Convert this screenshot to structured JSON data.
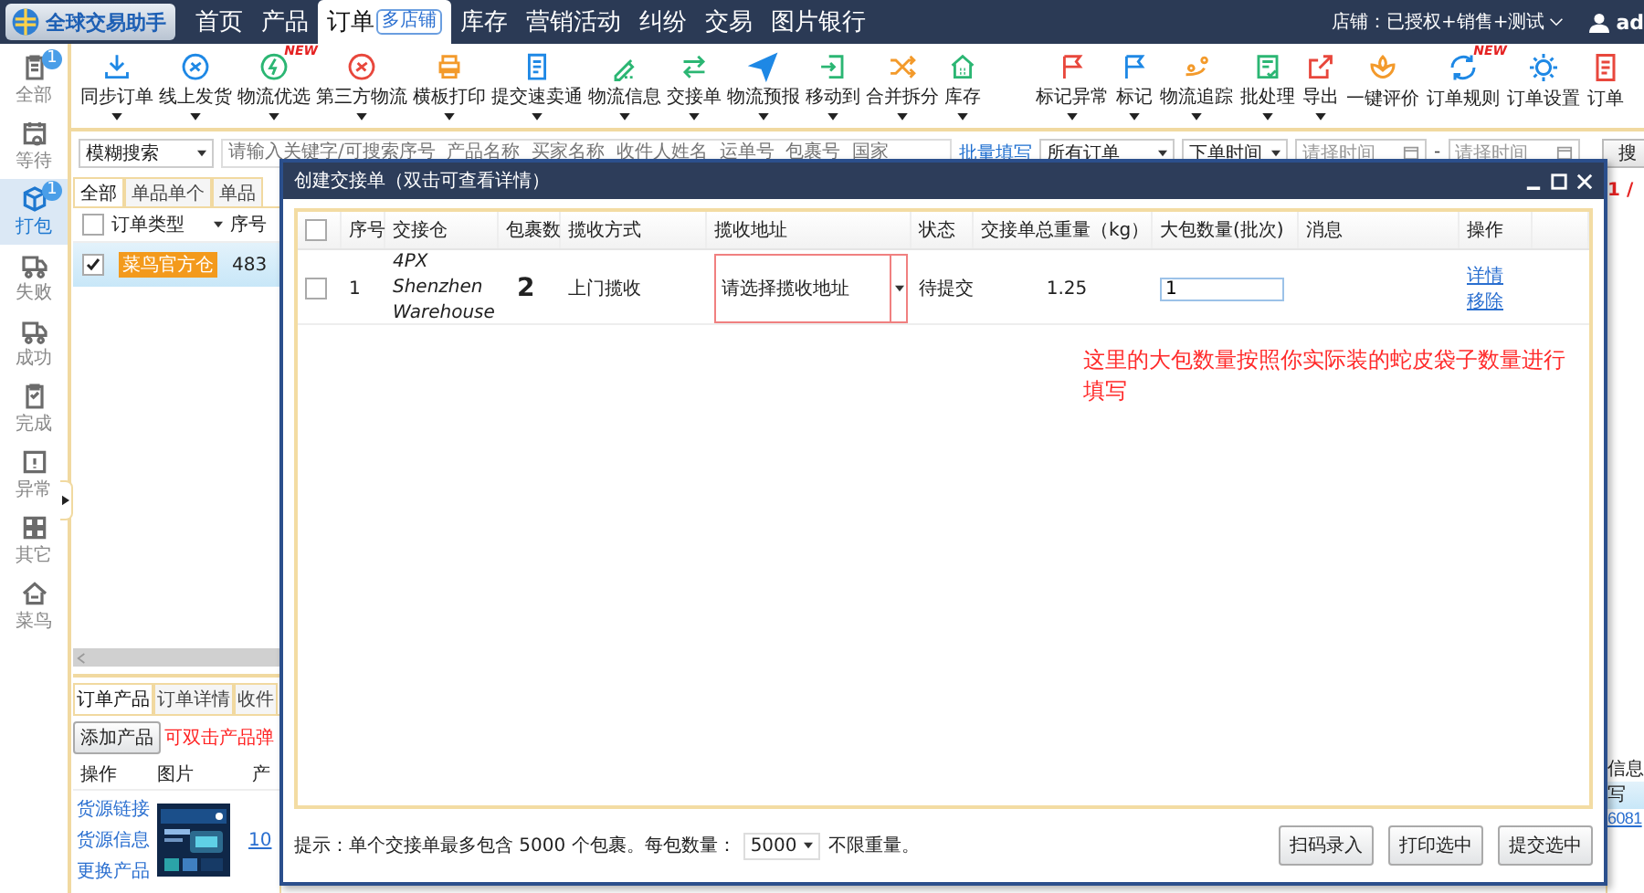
{
  "app": {
    "logo": "全球交易助手",
    "store": "店铺：已授权+销售+测试",
    "user": "ad",
    "nav": [
      {
        "label": "首页",
        "selected": false
      },
      {
        "label": "产品",
        "selected": false
      },
      {
        "label": "订单",
        "selected": true,
        "badge": "多店铺"
      },
      {
        "label": "库存",
        "selected": false
      },
      {
        "label": "营销活动",
        "selected": false
      },
      {
        "label": "纠纷",
        "selected": false
      },
      {
        "label": "交易",
        "selected": false
      },
      {
        "label": "图片银行",
        "selected": false
      }
    ]
  },
  "sidebar": [
    {
      "label": "全部",
      "selected": false,
      "badge": "1"
    },
    {
      "label": "等待",
      "selected": false
    },
    {
      "label": "打包",
      "selected": true,
      "badge": "1"
    },
    {
      "label": "失败",
      "selected": false
    },
    {
      "label": "成功",
      "selected": false
    },
    {
      "label": "完成",
      "selected": false
    },
    {
      "label": "异常",
      "selected": false
    },
    {
      "label": "其它",
      "selected": false
    },
    {
      "label": "菜鸟",
      "selected": false
    }
  ],
  "toolbar": [
    [
      {
        "label": "同步订单",
        "dropdown": true
      },
      {
        "label": "线上发货",
        "dropdown": true
      },
      {
        "label": "物流优选",
        "dropdown": true,
        "badge": "NEW"
      },
      {
        "label": "第三方物流",
        "dropdown": true
      },
      {
        "label": "横板打印",
        "dropdown": true
      },
      {
        "label": "提交速卖通",
        "dropdown": true
      },
      {
        "label": "物流信息",
        "dropdown": true
      },
      {
        "label": "交接单",
        "dropdown": true
      },
      {
        "label": "物流预报",
        "dropdown": true
      },
      {
        "label": "移动到",
        "dropdown": true
      },
      {
        "label": "合并拆分",
        "dropdown": true
      },
      {
        "label": "库存",
        "dropdown": true
      }
    ],
    [
      {
        "label": "标记异常",
        "dropdown": true
      },
      {
        "label": "标记",
        "dropdown": true
      },
      {
        "label": "物流追踪",
        "dropdown": true
      },
      {
        "label": "批处理",
        "dropdown": true
      },
      {
        "label": "导出",
        "dropdown": true
      },
      {
        "label": "一键评价",
        "dropdown": false
      },
      {
        "label": "订单规则",
        "dropdown": false,
        "badge": "NEW"
      },
      {
        "label": "订单设置",
        "dropdown": false
      },
      {
        "label": "订单",
        "dropdown": false
      }
    ]
  ],
  "filter": {
    "search_mode": "模糊搜索",
    "search_placeholder": "请输入关键字/可搜索序号  产品名称  买家名称  收件人姓名  运单号  包裹号  国家",
    "batch_link": "批量填写",
    "order_scope": "所有订单",
    "time_type": "下单时间",
    "start_placeholder": "请择时间",
    "separator": "-",
    "end_placeholder": "请择时间",
    "search_button": "搜"
  },
  "order_list": {
    "tabs": [
      {
        "label": "全部",
        "selected": true
      },
      {
        "label": "单品单个",
        "selected": false
      },
      {
        "label": "单品",
        "selected": false
      }
    ],
    "header_checked": false,
    "columns": [
      "订单类型",
      "序号"
    ],
    "rows": [
      {
        "checked": true,
        "selected": true,
        "tag": "菜鸟官方仓",
        "number": "483",
        "column_cut": "写"
      }
    ],
    "page": "1 /",
    "header_cut": "信息"
  },
  "detail_panel": {
    "tabs": [
      {
        "label": "订单产品",
        "selected": true
      },
      {
        "label": "订单详情",
        "selected": false
      },
      {
        "label": "收件",
        "selected": false
      }
    ],
    "add_button": "添加产品",
    "hint": "可双击产品弹",
    "columns": [
      "操作",
      "图片",
      "产"
    ],
    "links": [
      "货源链接",
      "货源信息",
      "更换产品"
    ],
    "product_link": "10",
    "right_link": "6081"
  },
  "dialog": {
    "title": "创建交接单（双击可查看详情）",
    "header_checked": false,
    "columns": [
      "序号",
      "交接仓",
      "包裹数",
      "揽收方式",
      "揽收地址",
      "状态",
      "交接单总重量（kg）",
      "大包数量(批次)",
      "消息",
      "操作"
    ],
    "rows": [
      {
        "checked": false,
        "number": "1",
        "warehouse": "4PX Shenzhen Warehouse",
        "packages": "2",
        "pickup": "上门揽收",
        "address_placeholder": "请选择揽收地址",
        "address_invalid": true,
        "status": "待提交",
        "weight": "1.25",
        "bags": "1",
        "actions": [
          "详情",
          "移除"
        ]
      }
    ],
    "annotation": "这里的大包数量按照你实际装的蛇皮袋子数量进行填写",
    "footer": {
      "hint_before": "提示：单个交接单最多包含 5000 个包裹。每包数量：",
      "per_bag": "5000",
      "hint_after": "不限重量。"
    },
    "buttons": [
      "扫码录入",
      "打印选中",
      "提交选中"
    ]
  }
}
